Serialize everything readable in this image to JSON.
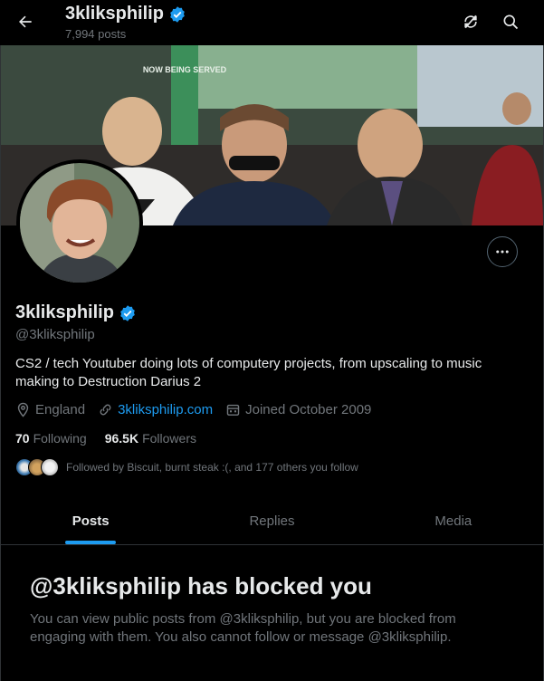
{
  "header": {
    "name": "3kliksphilip",
    "post_count": "7,994 posts"
  },
  "profile": {
    "name": "3kliksphilip",
    "handle": "@3kliksphilip",
    "bio": "CS2 / tech Youtuber doing lots of computery projects, from upscaling to music making to Destruction Darius 2",
    "location": "England",
    "website": "3kliksphilip.com",
    "joined": "Joined October 2009",
    "following_count": "70",
    "following_label": "Following",
    "followers_count": "96.5K",
    "followers_label": "Followers",
    "followed_by": "Followed by Biscuit, burnt steak :(, and 177 others you follow",
    "banner_sign": "NOW BEING SERVED",
    "accent": "#1d9bf0"
  },
  "tabs": [
    {
      "label": "Posts",
      "active": true
    },
    {
      "label": "Replies",
      "active": false
    },
    {
      "label": "Media",
      "active": false
    }
  ],
  "blocked": {
    "title": "@3kliksphilip has blocked you",
    "message": "You can view public posts from @3kliksphilip, but you are blocked from engaging with them. You also cannot follow or message @3kliksphilip."
  },
  "icons": [
    "back-arrow-icon",
    "verified-badge-icon",
    "refresh-icon",
    "search-icon",
    "more-icon",
    "location-icon",
    "link-icon",
    "calendar-icon"
  ]
}
